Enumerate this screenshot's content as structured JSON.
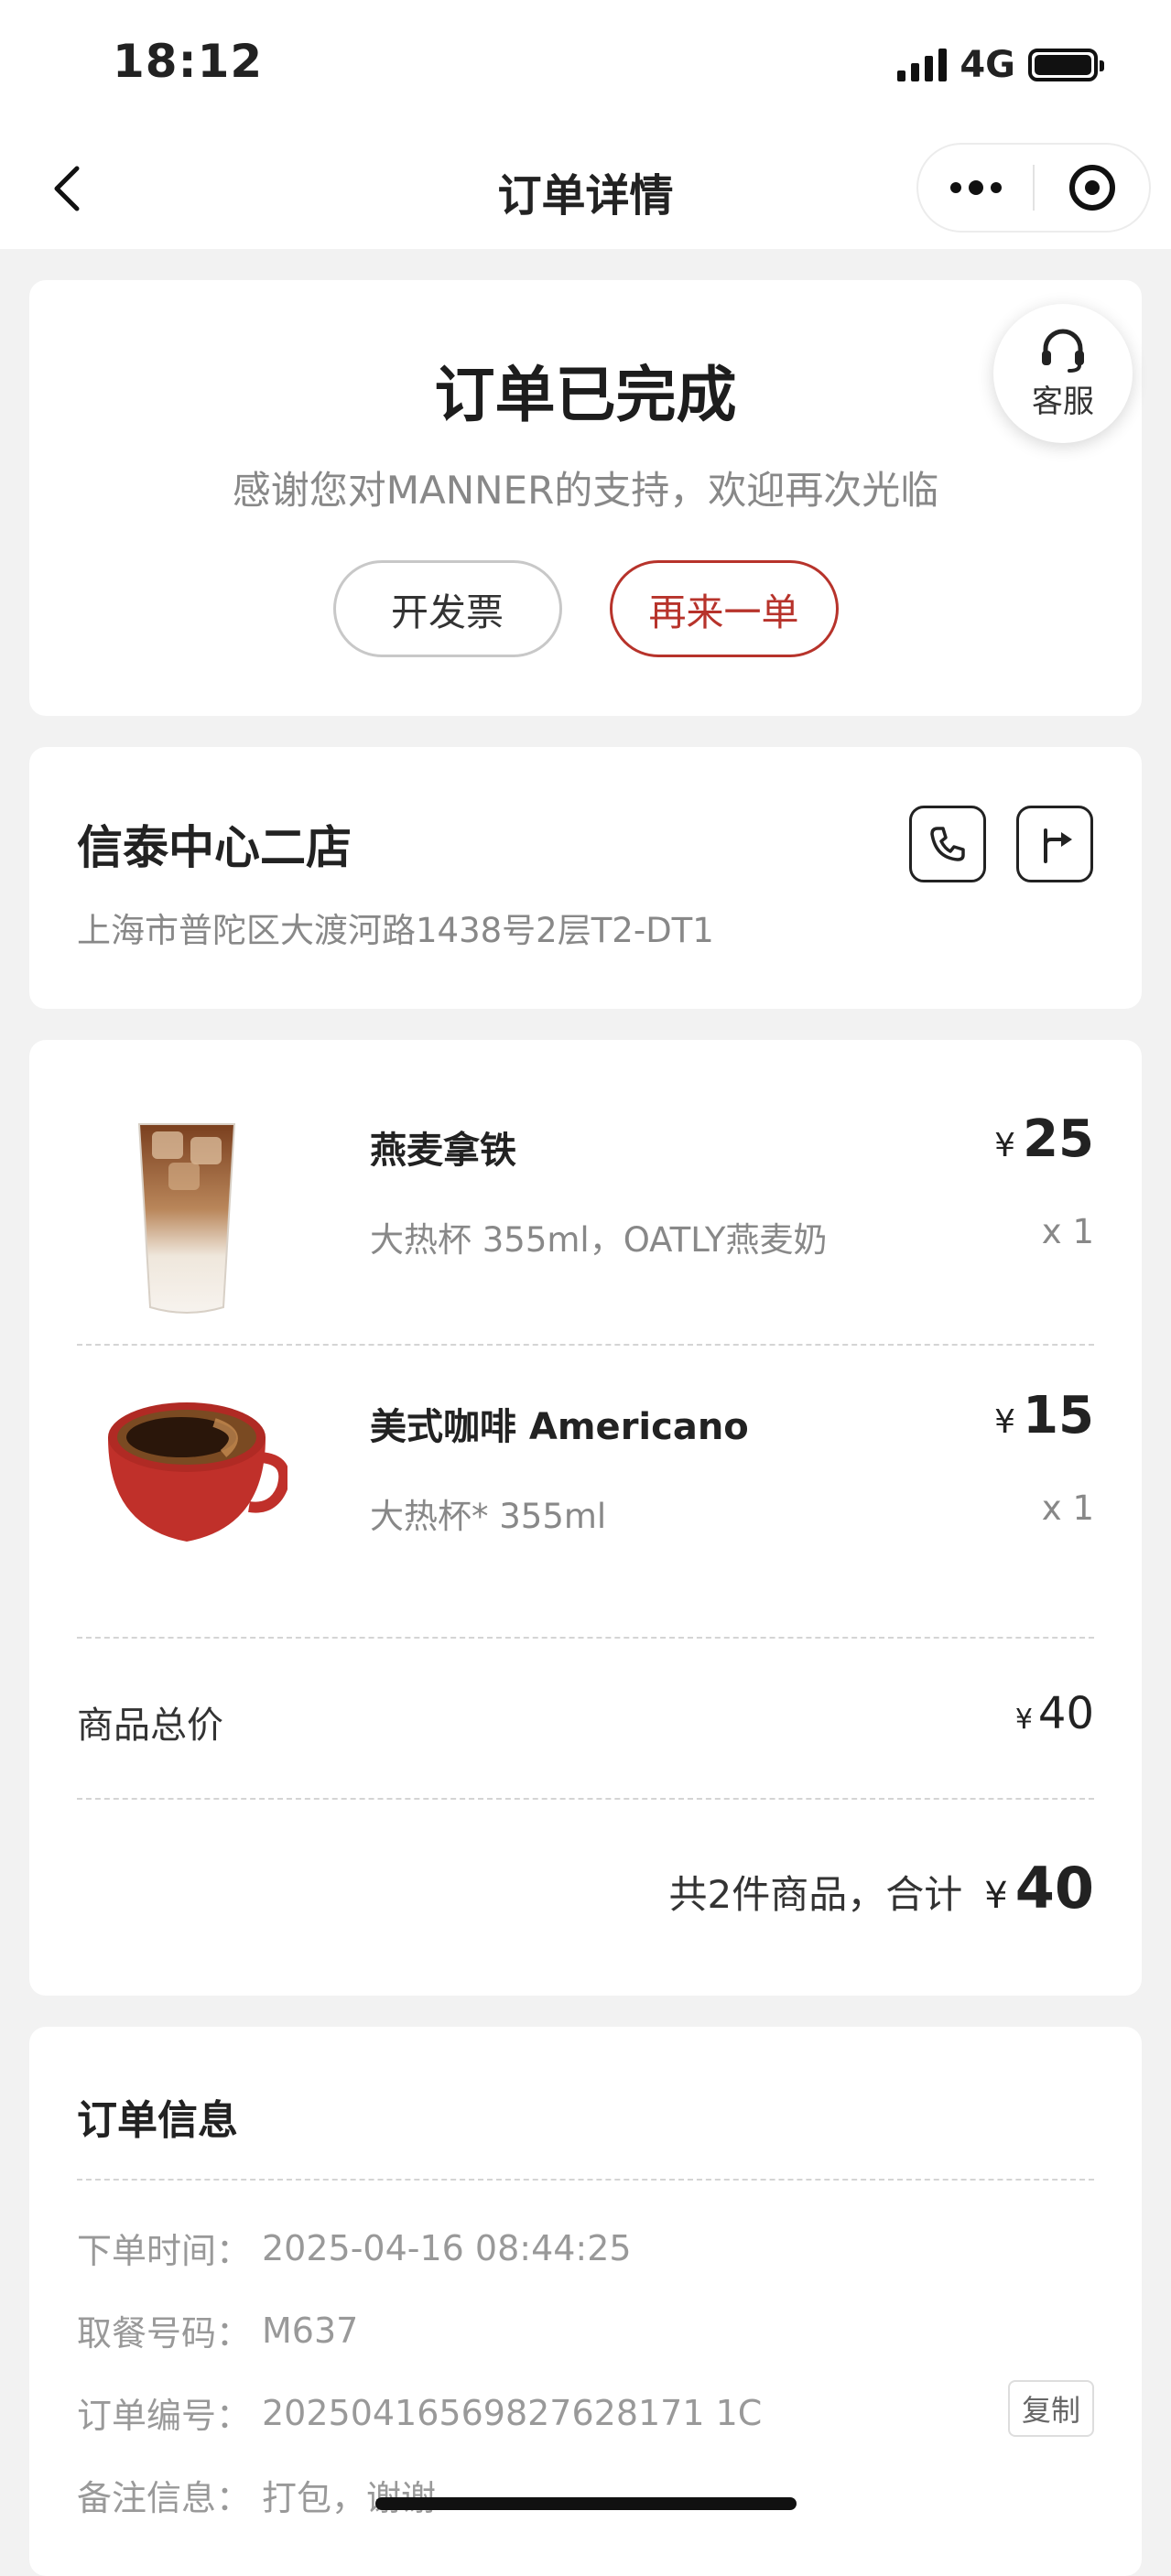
{
  "status_bar": {
    "time": "18:12",
    "network": "4G"
  },
  "nav": {
    "title": "订单详情"
  },
  "order_status": {
    "title": "订单已完成",
    "subtitle": "感谢您对MANNER的支持，欢迎再次光临",
    "invoice_button": "开发票",
    "reorder_button": "再来一单",
    "customer_service": "客服",
    "accent_color": "#b7332b"
  },
  "store": {
    "name": "信泰中心二店",
    "address": "上海市普陀区大渡河路1438号2层T2-DT1"
  },
  "items": [
    {
      "name": "燕麦拿铁",
      "spec": "大热杯 355ml，OATLY燕麦奶",
      "currency": "¥",
      "price": "25",
      "qty": "x 1"
    },
    {
      "name": "美式咖啡 Americano",
      "spec": "大热杯* 355ml",
      "currency": "¥",
      "price": "15",
      "qty": "x 1"
    }
  ],
  "summary": {
    "subtotal_label": "商品总价",
    "currency": "¥",
    "subtotal_value": "40",
    "total_label": "共2件商品，合计",
    "total_value": "40"
  },
  "order_info": {
    "title": "订单信息",
    "rows": [
      {
        "key": "下单时间：",
        "value": "2025-04-16 08:44:25"
      },
      {
        "key": "取餐号码：",
        "value": "M637"
      },
      {
        "key": "订单编号：",
        "value": "20250416569827628171 1C"
      },
      {
        "key": "备注信息：",
        "value": "打包，谢谢"
      }
    ],
    "copy_button": "复制"
  }
}
